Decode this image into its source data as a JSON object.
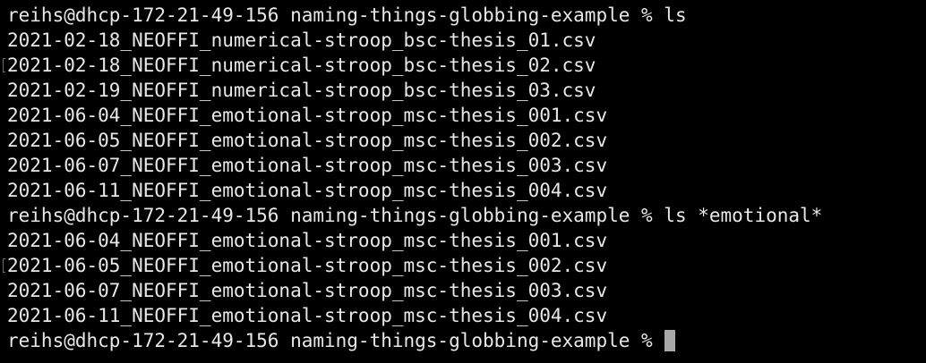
{
  "terminal": {
    "cursor_color": "#a8a8a8",
    "prompt": "reihs@dhcp-172-21-49-156 naming-things-globbing-example %",
    "lines": [
      {
        "kind": "prompt",
        "text": "reihs@dhcp-172-21-49-156 naming-things-globbing-example % ls"
      },
      {
        "kind": "output",
        "text": "2021-02-18_NEOFFI_numerical-stroop_bsc-thesis_01.csv"
      },
      {
        "kind": "output",
        "text": "2021-02-18_NEOFFI_numerical-stroop_bsc-thesis_02.csv",
        "marked": true
      },
      {
        "kind": "output",
        "text": "2021-02-19_NEOFFI_numerical-stroop_bsc-thesis_03.csv"
      },
      {
        "kind": "output",
        "text": "2021-06-04_NEOFFI_emotional-stroop_msc-thesis_001.csv"
      },
      {
        "kind": "output",
        "text": "2021-06-05_NEOFFI_emotional-stroop_msc-thesis_002.csv"
      },
      {
        "kind": "output",
        "text": "2021-06-07_NEOFFI_emotional-stroop_msc-thesis_003.csv"
      },
      {
        "kind": "output",
        "text": "2021-06-11_NEOFFI_emotional-stroop_msc-thesis_004.csv"
      },
      {
        "kind": "prompt",
        "text": "reihs@dhcp-172-21-49-156 naming-things-globbing-example % ls *emotional*"
      },
      {
        "kind": "output",
        "text": "2021-06-04_NEOFFI_emotional-stroop_msc-thesis_001.csv"
      },
      {
        "kind": "output",
        "text": "2021-06-05_NEOFFI_emotional-stroop_msc-thesis_002.csv",
        "marked": true
      },
      {
        "kind": "output",
        "text": "2021-06-07_NEOFFI_emotional-stroop_msc-thesis_003.csv"
      },
      {
        "kind": "output",
        "text": "2021-06-11_NEOFFI_emotional-stroop_msc-thesis_004.csv"
      }
    ],
    "current_prompt": "reihs@dhcp-172-21-49-156 naming-things-globbing-example % "
  }
}
